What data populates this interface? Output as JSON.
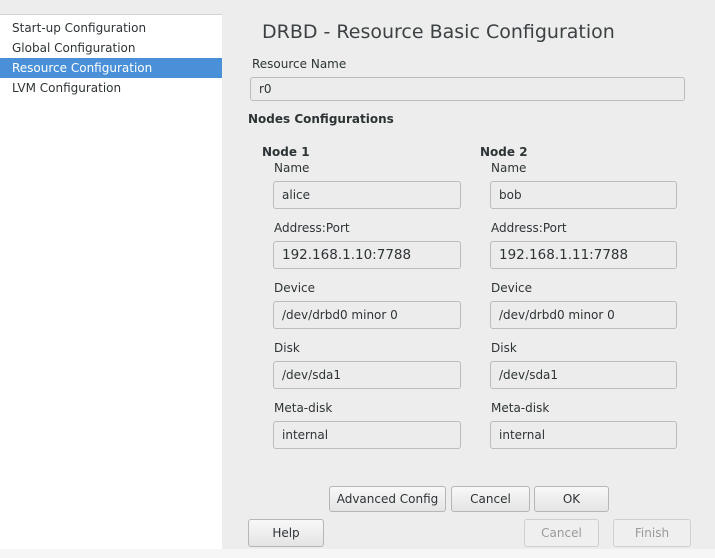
{
  "sidebar": {
    "items": [
      {
        "label": "Start-up Configuration"
      },
      {
        "label": "Global Configuration"
      },
      {
        "label": "Resource Configuration"
      },
      {
        "label": "LVM Configuration"
      }
    ]
  },
  "page": {
    "title": "DRBD - Resource Basic Configuration",
    "resource_name_label": "Resource Name",
    "resource_name_value": "r0",
    "nodes_configurations_label": "Nodes Configurations"
  },
  "nodes": [
    {
      "heading": "Node 1",
      "name_label": "Name",
      "name_value": "alice",
      "address_label": "Address:Port",
      "address_value": "192.168.1.10:7788",
      "device_label": "Device",
      "device_value": "/dev/drbd0 minor 0",
      "disk_label": "Disk",
      "disk_value": "/dev/sda1",
      "metadisk_label": "Meta-disk",
      "metadisk_value": "internal"
    },
    {
      "heading": "Node 2",
      "name_label": "Name",
      "name_value": "bob",
      "address_label": "Address:Port",
      "address_value": "192.168.1.11:7788",
      "device_label": "Device",
      "device_value": "/dev/drbd0 minor 0",
      "disk_label": "Disk",
      "disk_value": "/dev/sda1",
      "metadisk_label": "Meta-disk",
      "metadisk_value": "internal"
    }
  ],
  "buttons": {
    "advanced": "Advanced Config",
    "cancel_inner": "Cancel",
    "ok": "OK",
    "help": "Help",
    "cancel": "Cancel",
    "finish": "Finish"
  }
}
